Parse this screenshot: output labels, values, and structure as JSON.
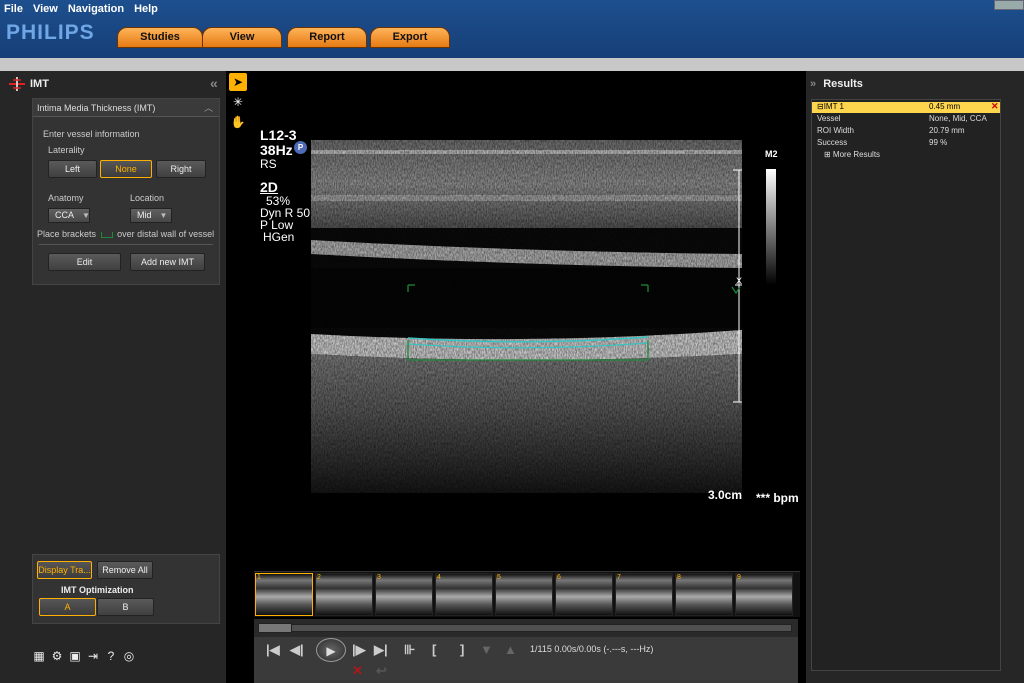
{
  "menu": [
    "File",
    "View",
    "Navigation",
    "Help"
  ],
  "brand": "PHILIPS",
  "nav_tabs": [
    "Studies",
    "View",
    "Report",
    "Export"
  ],
  "imt_panel": {
    "title": "IMT",
    "box_title": "Intima Media Thickness (IMT)",
    "enter_vessel": "Enter vessel information",
    "laterality_label": "Laterality",
    "laterality_options": [
      "Left",
      "None",
      "Right"
    ],
    "laterality_selected": "None",
    "anatomy_label": "Anatomy",
    "anatomy_value": "CCA",
    "location_label": "Location",
    "location_value": "Mid",
    "bracket_hint_pre": "Place brackets",
    "bracket_hint_post": "over distal wall of vessel",
    "edit_label": "Edit",
    "add_new_label": "Add new IMT"
  },
  "bottom_tools": {
    "display_label": "Display Tra...",
    "remove_all_label": "Remove All",
    "imt_opt_label": "IMT Optimization",
    "opt_a": "A",
    "opt_b": "B"
  },
  "image_info": {
    "probe": "L12-3",
    "freq": "38Hz",
    "preset": "RS",
    "mode": "2D",
    "gain": "53%",
    "dyn": "Dyn R 50",
    "power": "P Low",
    "hgen": "HGen",
    "badge": "P",
    "colorbar_label": "M2",
    "depth": "3.0cm",
    "bpm": "*** bpm",
    "marker": "X"
  },
  "playback": {
    "frame_info": "1/115  0.00s/0.00s (-.---s, ---Hz)"
  },
  "thumbnails": [
    "1",
    "2",
    "3",
    "4",
    "5",
    "6",
    "7",
    "8",
    "9"
  ],
  "results": {
    "title": "Results",
    "rows": [
      {
        "key": "IMT 1",
        "value": "0.45 mm",
        "highlight": true
      },
      {
        "key": "Vessel",
        "value": "None, Mid, CCA"
      },
      {
        "key": "ROI Width",
        "value": "20.79 mm"
      },
      {
        "key": "Success",
        "value": "99 %"
      }
    ],
    "more": "More Results"
  },
  "colors": {
    "accent": "#ffb000",
    "topbar": "#1d4f8e",
    "tab": "#f29233",
    "panel": "#262626",
    "imt_line": "#37c3c3",
    "bracket": "#1c8a3a"
  }
}
